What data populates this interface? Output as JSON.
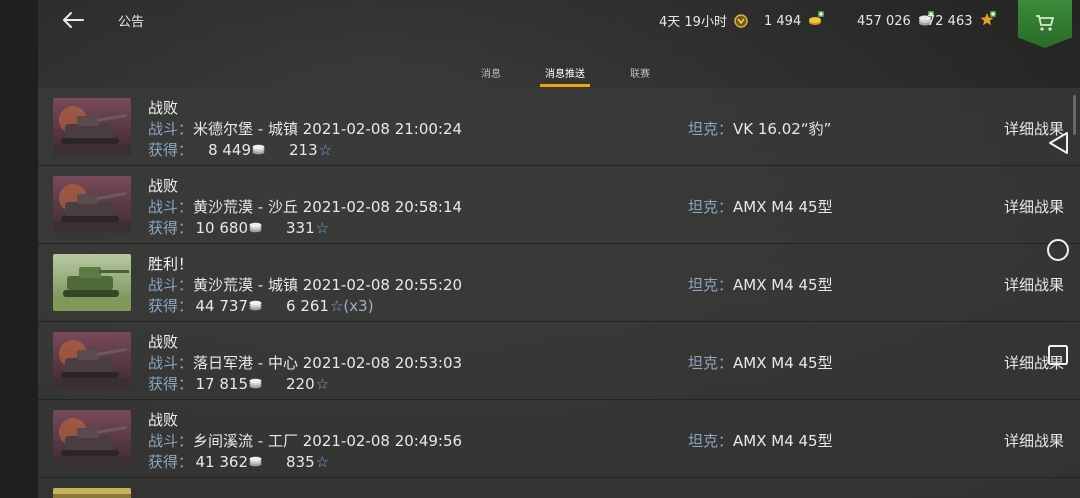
{
  "header": {
    "title": "公告",
    "timer": "4天 19小时",
    "gold": "1 494",
    "silver": "457 026",
    "free_xp": "72 463"
  },
  "tabs": [
    {
      "label": "消息",
      "active": false
    },
    {
      "label": "消息推送",
      "active": true
    },
    {
      "label": "联赛",
      "active": false
    }
  ],
  "labels": {
    "battle": "战斗：",
    "earned": "获得：",
    "tank": "坦克：",
    "details": "详细战果"
  },
  "rows": [
    {
      "result": "战败",
      "map": "米德尔堡 - 城镇",
      "datetime": "2021-02-08 21:00:24",
      "silver": "8 449",
      "xp": "213",
      "mult": "",
      "tank": "VK 16.02“豹”",
      "thumb": "defeat"
    },
    {
      "result": "战败",
      "map": "黄沙荒漠 - 沙丘",
      "datetime": "2021-02-08 20:58:14",
      "silver": "10 680",
      "xp": "331",
      "mult": "",
      "tank": "AMX M4 45型",
      "thumb": "defeat"
    },
    {
      "result": "胜利！",
      "map": "黄沙荒漠 - 城镇",
      "datetime": "2021-02-08 20:55:20",
      "silver": "44 737",
      "xp": "6 261",
      "mult": "(x3)",
      "tank": "AMX M4 45型",
      "thumb": "victory"
    },
    {
      "result": "战败",
      "map": "落日军港 - 中心",
      "datetime": "2021-02-08 20:53:03",
      "silver": "17 815",
      "xp": "220",
      "mult": "",
      "tank": "AMX M4 45型",
      "thumb": "defeat"
    },
    {
      "result": "战败",
      "map": "乡间溪流 - 工厂",
      "datetime": "2021-02-08 20:49:56",
      "silver": "41 362",
      "xp": "835",
      "mult": "",
      "tank": "AMX M4 45型",
      "thumb": "defeat"
    }
  ],
  "colors": {
    "accent": "#f0a500",
    "label": "#8aa6c2",
    "shop": "#3c8b3a"
  },
  "icons": [
    "back-arrow-icon",
    "timer-badge-icon",
    "gold-icon",
    "silver-icon",
    "free-xp-icon",
    "shopping-cart-icon",
    "star-icon",
    "nav-back-icon",
    "nav-home-icon",
    "nav-recents-icon"
  ]
}
